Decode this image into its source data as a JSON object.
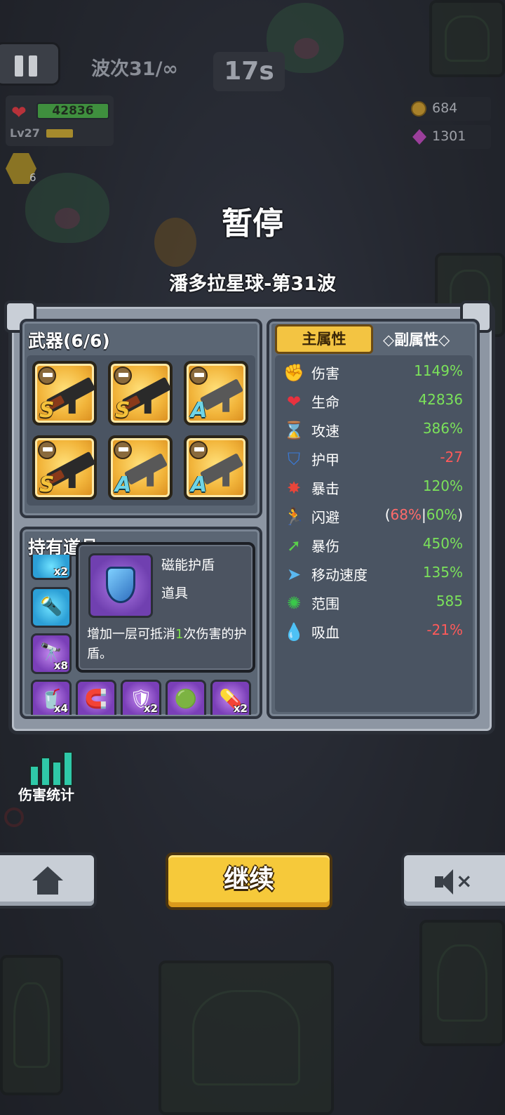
{
  "hud": {
    "wave_label": "波次31/∞",
    "timer": "17s",
    "hp_value": "42836",
    "level": "Lv27",
    "weapon_count": "6",
    "coins": "684",
    "gems": "1301"
  },
  "title": "暂停",
  "stage_name": "潘多拉星球-第31波",
  "weapons": {
    "title": "武器(6/6)",
    "slots": [
      {
        "type": "ak",
        "rank": "S"
      },
      {
        "type": "ak",
        "rank": "S"
      },
      {
        "type": "smg",
        "rank": "A"
      },
      {
        "type": "ak",
        "rank": "S"
      },
      {
        "type": "smg",
        "rank": "A"
      },
      {
        "type": "smg",
        "rank": "A"
      }
    ]
  },
  "items": {
    "title": "持有道具",
    "counts": {
      "item1": "x2",
      "binoculars": "x8",
      "drink": "x4",
      "shield": "x2",
      "capsule": "x2"
    }
  },
  "tooltip": {
    "name": "磁能护盾",
    "type": "道具",
    "desc_part1": "增加一层可抵消",
    "desc_highlight": "1",
    "desc_part2": "次伤害的护盾。"
  },
  "stats": {
    "tab_main": "主属性",
    "tab_sub": "◇副属性◇",
    "rows": [
      {
        "name": "伤害",
        "value": "1149%",
        "icon": "fist-icon"
      },
      {
        "name": "生命",
        "value": "42836",
        "icon": "heart-icon"
      },
      {
        "name": "攻速",
        "value": "386%",
        "icon": "hourglass-icon"
      },
      {
        "name": "护甲",
        "value": "-27",
        "icon": "shield-icon"
      },
      {
        "name": "暴击",
        "value": "120%",
        "icon": "crit-icon"
      },
      {
        "name": "闪避",
        "value_open": "(",
        "value_a": "68%",
        "value_sep": "|",
        "value_b": "60%",
        "value_close": ")",
        "icon": "dodge-icon"
      },
      {
        "name": "暴伤",
        "value": "450%",
        "icon": "crit-damage-icon"
      },
      {
        "name": "移动速度",
        "value": "135%",
        "icon": "speed-icon"
      },
      {
        "name": "范围",
        "value": "585",
        "icon": "range-icon"
      },
      {
        "name": "吸血",
        "value": "-21%",
        "icon": "lifesteal-icon"
      }
    ]
  },
  "damage_stats_label": "伤害统计",
  "continue_label": "继续",
  "colors": {
    "positive": "#7be25a",
    "negative": "#ff5a5a",
    "gold_button": "#f6c93a"
  }
}
